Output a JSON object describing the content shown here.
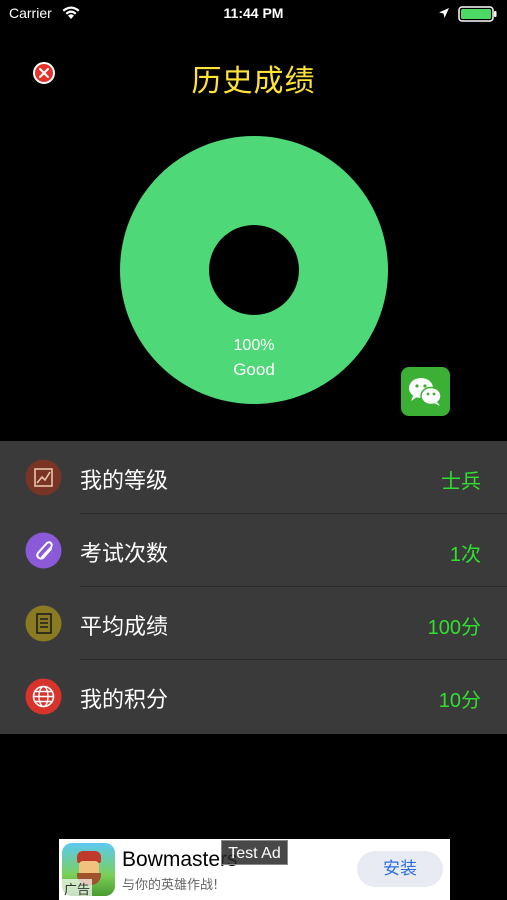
{
  "status_bar": {
    "carrier": "Carrier",
    "time": "11:44 PM",
    "icons": [
      "wifi-icon",
      "location-icon",
      "battery-icon"
    ]
  },
  "header": {
    "title": "历史成绩",
    "close_icon": "close-icon"
  },
  "chart_data": {
    "type": "pie",
    "categories": [
      "Good"
    ],
    "values": [
      100
    ],
    "percent_label": "100%",
    "grade_label": "Good",
    "colors": [
      "#4ed878"
    ]
  },
  "share": {
    "icon": "wechat-icon",
    "color": "#3cb035"
  },
  "stats": [
    {
      "label": "我的等级",
      "value": "士兵",
      "icon": "chart-icon",
      "icon_color": "#7a3426"
    },
    {
      "label": "考试次数",
      "value": "1次",
      "icon": "paperclip-icon",
      "icon_color": "#8a5ad8"
    },
    {
      "label": "平均成绩",
      "value": "100分",
      "icon": "document-icon",
      "icon_color": "#8a7a22"
    },
    {
      "label": "我的积分",
      "value": "10分",
      "icon": "globe-icon",
      "icon_color": "#d9342b"
    }
  ],
  "colors": {
    "title": "#ffe336",
    "value": "#2fe02f",
    "panel": "#3a3a3a"
  },
  "ad": {
    "test_label": "Test Ad",
    "title": "Bowmasters",
    "subtitle": "与你的英雄作战!",
    "tag": "广告",
    "install_label": "安装"
  }
}
